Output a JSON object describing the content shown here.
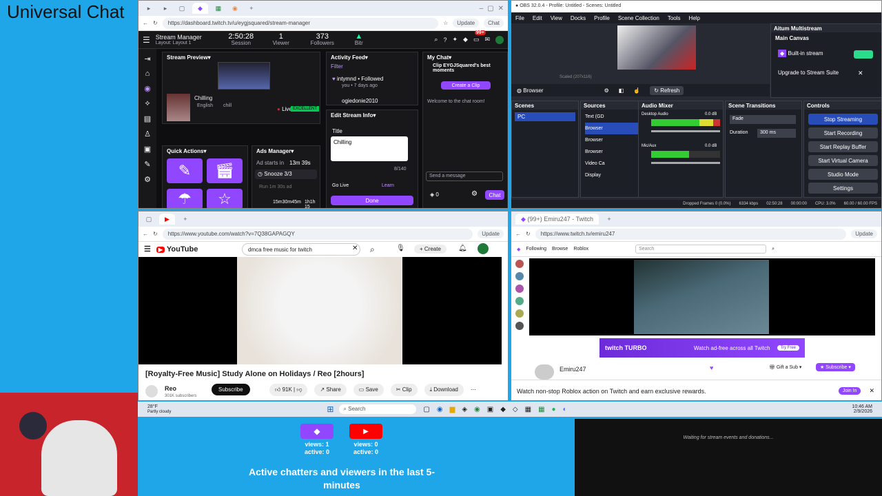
{
  "overlay": {
    "title": "Universal Chat",
    "waiting": "Waiting for stream events and donations...",
    "chatters_caption": "Active chatters and viewers in the last 5-minutes",
    "twitch": {
      "views": "views: 1",
      "active": "active: 0"
    },
    "youtube": {
      "views": "views: 0",
      "active": "active: 0"
    },
    "colors": {
      "twitch": "#9147ff",
      "youtube": "#ff0000",
      "bg": "#1ea6e9"
    }
  },
  "dashboard": {
    "url": "https://dashboard.twitch.tv/u/eygjsquared/stream-manager",
    "update": "Update",
    "chat_btn": "Chat",
    "title": "Stream Manager",
    "layout": "Layout: Layout 1",
    "stats": [
      {
        "value": "2:50:28",
        "label": "Session"
      },
      {
        "value": "1",
        "label": "Viewer"
      },
      {
        "value": "373",
        "label": "Followers"
      },
      {
        "value": "",
        "label": "Bitr"
      }
    ],
    "badge": "99+",
    "preview": {
      "header": "Stream Preview",
      "title": "Chilling",
      "lang": "English",
      "tag": "chill",
      "live": "Live",
      "quality": "EXCELLENT"
    },
    "quick_actions": "Quick Actions",
    "ads": {
      "header": "Ads Manager",
      "next": "Ad starts in",
      "time": "13m 39s",
      "snooze": "Snooze 3/3",
      "run": "Run 1m 30s ad",
      "timer": "15m30m45m",
      "timer2": "1h1h 15"
    },
    "activity": {
      "header": "Activity Feed",
      "filter": "Filter",
      "user": "intymnd",
      "action": "Followed",
      "by": "you",
      "when": "7 days ago",
      "user2": "ogiedonie2010"
    },
    "edit": {
      "header": "Edit Stream Info",
      "title_label": "Title",
      "title_value": "Chilling",
      "count": "8/140",
      "golive": "Go Live",
      "learn": "Learn",
      "done": "Done"
    },
    "chat": {
      "header": "My Chat",
      "clip_text": "Clip EYGJSquared's best moments",
      "create_clip": "Create a Clip",
      "welcome": "Welcome to the chat room!",
      "placeholder": "Send a message",
      "points": "0",
      "chat_btn": "Chat"
    }
  },
  "obs": {
    "title": "OBS 32.0.4 - Profile: Untitled - Scenes: Untitled",
    "menu": [
      "File",
      "Edit",
      "View",
      "Docks",
      "Profile",
      "Scene Collection",
      "Tools",
      "Help"
    ],
    "source_label": "Browser",
    "refresh": "Refresh",
    "scaled": "Scaled (207x116)",
    "scenes": {
      "header": "Scenes",
      "items": [
        "PC"
      ]
    },
    "sources": {
      "header": "Sources",
      "items": [
        "Text (GD",
        "Browser",
        "Browser",
        "Browser",
        "Video Ca",
        "Display"
      ]
    },
    "mixer": {
      "header": "Audio Mixer",
      "ch1": "Desktop Audio",
      "ch1v": "0.0 dB",
      "ch2": "Mic/Aux",
      "ch2v": "0.0 dB"
    },
    "transitions": {
      "header": "Scene Transitions",
      "type": "Fade",
      "dur_label": "Duration",
      "dur": "300 ms"
    },
    "controls": {
      "header": "Controls",
      "buttons": [
        "Stop Streaming",
        "Start Recording",
        "Start Replay Buffer",
        "Start Virtual Camera",
        "Studio Mode",
        "Settings"
      ]
    },
    "multistream": {
      "header": "Aitum Multistream",
      "canvas": "Main Canvas",
      "builtin": "Built-in stream",
      "upgrade": "Upgrade to Stream Suite"
    },
    "status": {
      "dropped": "Dropped Frames 0 (0.0%)",
      "kbps": "6334 kbps",
      "time": "02:50:28",
      "rec": "00:00:00",
      "cpu": "CPU: 3.0%",
      "fps": "60.00 / 60.00 FPS"
    }
  },
  "youtube": {
    "url": "https://www.youtube.com/watch?v=7Q38GAPAGQY",
    "search": "dmca free music for twitch",
    "create": "Create",
    "video_title": "[Royalty-Free Music] Study Alone on Holidays / Reo [2hours]",
    "channel": "Reo",
    "subs": "301K subscribers",
    "subscribe": "Subscribe",
    "likes": "91K",
    "share": "Share",
    "save": "Save",
    "clip": "Clip",
    "download": "Download",
    "logo": "YouTube"
  },
  "twitch_viewer": {
    "tab": "(99+) Emiru247 - Twitch",
    "url": "https://www.twitch.tv/emiru247",
    "nav": [
      "Following",
      "Browse",
      "Roblox"
    ],
    "search": "Search",
    "turbo": "Watch ad-free across all Twitch",
    "try_free": "Try Free",
    "streamer": "Emiru247",
    "gift": "Gift a Sub",
    "subscribe": "Subscribe",
    "banner": "Watch non-stop Roblox action on Twitch and earn exclusive rewards.",
    "join": "Join In",
    "turbo_logo": "twitch TURBO"
  },
  "taskbar": {
    "weather": "28°F",
    "weather2": "Partly cloudy",
    "search": "Search",
    "time": "10:46 AM",
    "date": "2/9/2026"
  }
}
